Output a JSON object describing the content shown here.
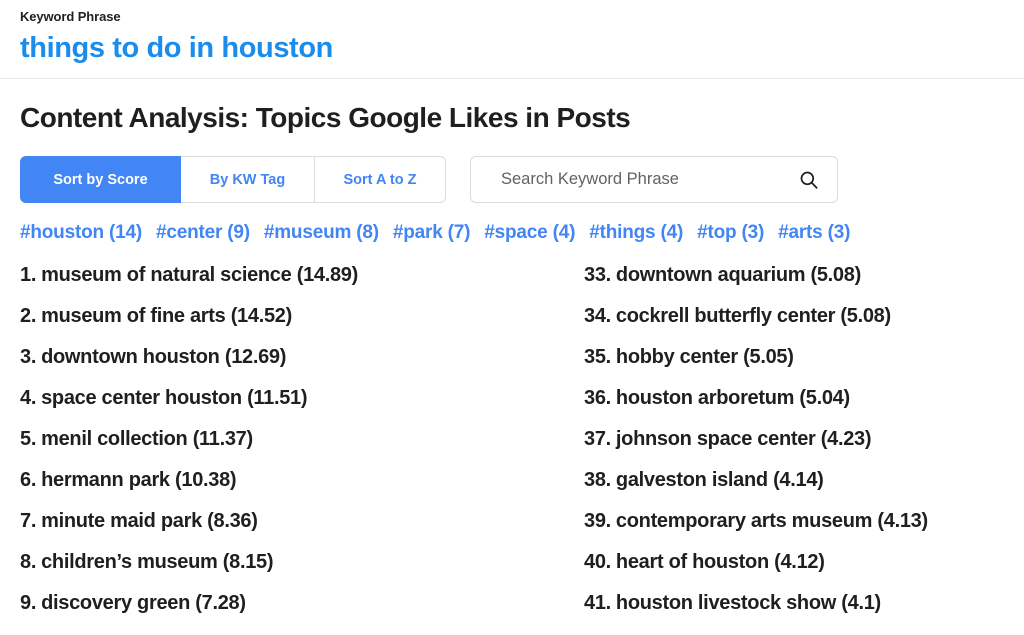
{
  "header": {
    "keyword_label": "Keyword Phrase",
    "keyword_phrase": "things to do in houston",
    "accent_blue": "#1a8ceb"
  },
  "page_title": "Content Analysis: Topics Google Likes in Posts",
  "controls": {
    "tabs": [
      {
        "label": "Sort by Score",
        "active": true
      },
      {
        "label": "By KW Tag",
        "active": false
      },
      {
        "label": "Sort A to Z",
        "active": false
      }
    ],
    "search": {
      "placeholder": "Search Keyword Phrase",
      "value": "",
      "icon": "search-icon"
    },
    "active_color": "#4285f4",
    "border_color": "#dadce0"
  },
  "tags": [
    {
      "label": "#houston (14)"
    },
    {
      "label": "#center (9)"
    },
    {
      "label": "#museum (8)"
    },
    {
      "label": "#park (7)"
    },
    {
      "label": "#space (4)"
    },
    {
      "label": "#things (4)"
    },
    {
      "label": "#top (3)"
    },
    {
      "label": "#arts (3)"
    }
  ],
  "topics": {
    "left_column": [
      {
        "rank": "1.",
        "text": "museum of natural science (14.89)"
      },
      {
        "rank": "2.",
        "text": "museum of fine arts (14.52)"
      },
      {
        "rank": "3.",
        "text": "downtown houston (12.69)"
      },
      {
        "rank": "4.",
        "text": "space center houston (11.51)"
      },
      {
        "rank": "5.",
        "text": "menil collection (11.37)"
      },
      {
        "rank": "6.",
        "text": "hermann park (10.38)"
      },
      {
        "rank": "7.",
        "text": "minute maid park (8.36)"
      },
      {
        "rank": "8.",
        "text": "children’s museum (8.15)"
      },
      {
        "rank": "9.",
        "text": "discovery green (7.28)"
      }
    ],
    "right_column": [
      {
        "rank": "33.",
        "text": "downtown aquarium (5.08)"
      },
      {
        "rank": "34.",
        "text": "cockrell butterfly center (5.08)"
      },
      {
        "rank": "35.",
        "text": "hobby center (5.05)"
      },
      {
        "rank": "36.",
        "text": "houston arboretum (5.04)"
      },
      {
        "rank": "37.",
        "text": "johnson space center (4.23)"
      },
      {
        "rank": "38.",
        "text": "galveston island (4.14)"
      },
      {
        "rank": "39.",
        "text": "contemporary arts museum (4.13)"
      },
      {
        "rank": "40.",
        "text": "heart of houston (4.12)"
      },
      {
        "rank": "41.",
        "text": "houston livestock show (4.1)"
      }
    ]
  }
}
